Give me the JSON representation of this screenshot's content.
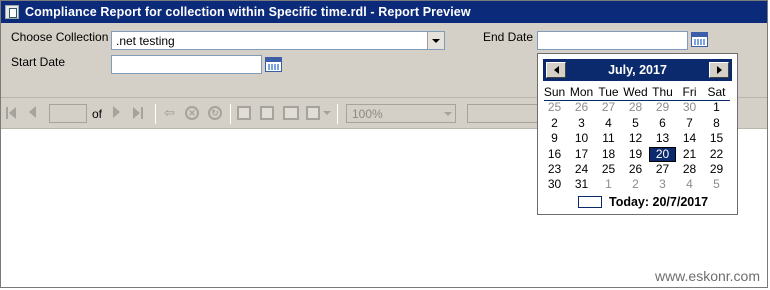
{
  "window": {
    "title": "Compliance Report for collection within Specific time.rdl - Report Preview"
  },
  "parameters": {
    "choose_collection_label": "Choose Collection",
    "choose_collection_value": ".net testing",
    "start_date_label": "Start Date",
    "start_date_value": "",
    "end_date_label": "End Date",
    "end_date_value": ""
  },
  "toolbar": {
    "page_current": "",
    "of_label": "of",
    "zoom_value": "100%",
    "icons": [
      "first-page-icon",
      "previous-page-icon",
      "next-page-icon",
      "last-page-icon",
      "back-icon",
      "stop-icon",
      "refresh-icon",
      "print-icon",
      "print-layout-icon",
      "page-setup-icon",
      "export-icon"
    ]
  },
  "calendar": {
    "month_year": "July, 2017",
    "weekdays": [
      "Sun",
      "Mon",
      "Tue",
      "Wed",
      "Thu",
      "Fri",
      "Sat"
    ],
    "weeks": [
      [
        {
          "d": "25",
          "o": true
        },
        {
          "d": "26",
          "o": true
        },
        {
          "d": "27",
          "o": true
        },
        {
          "d": "28",
          "o": true
        },
        {
          "d": "29",
          "o": true
        },
        {
          "d": "30",
          "o": true
        },
        {
          "d": "1",
          "o": false
        }
      ],
      [
        {
          "d": "2",
          "o": false
        },
        {
          "d": "3",
          "o": false
        },
        {
          "d": "4",
          "o": false
        },
        {
          "d": "5",
          "o": false
        },
        {
          "d": "6",
          "o": false
        },
        {
          "d": "7",
          "o": false
        },
        {
          "d": "8",
          "o": false
        }
      ],
      [
        {
          "d": "9",
          "o": false
        },
        {
          "d": "10",
          "o": false
        },
        {
          "d": "11",
          "o": false
        },
        {
          "d": "12",
          "o": false
        },
        {
          "d": "13",
          "o": false
        },
        {
          "d": "14",
          "o": false
        },
        {
          "d": "15",
          "o": false
        }
      ],
      [
        {
          "d": "16",
          "o": false
        },
        {
          "d": "17",
          "o": false
        },
        {
          "d": "18",
          "o": false
        },
        {
          "d": "19",
          "o": false
        },
        {
          "d": "20",
          "o": false,
          "selected": true
        },
        {
          "d": "21",
          "o": false
        },
        {
          "d": "22",
          "o": false
        }
      ],
      [
        {
          "d": "23",
          "o": false
        },
        {
          "d": "24",
          "o": false
        },
        {
          "d": "25",
          "o": false
        },
        {
          "d": "26",
          "o": false
        },
        {
          "d": "27",
          "o": false
        },
        {
          "d": "28",
          "o": false
        },
        {
          "d": "29",
          "o": false
        }
      ],
      [
        {
          "d": "30",
          "o": false
        },
        {
          "d": "31",
          "o": false
        },
        {
          "d": "1",
          "o": true
        },
        {
          "d": "2",
          "o": true
        },
        {
          "d": "3",
          "o": true
        },
        {
          "d": "4",
          "o": true
        },
        {
          "d": "5",
          "o": true
        }
      ]
    ],
    "today_label": "Today: 20/7/2017"
  },
  "watermark": "www.eskonr.com",
  "colors": {
    "title_bar": "#0b2a7a",
    "calendar_header": "#0b2a6d",
    "panel": "#d4d0c8"
  }
}
